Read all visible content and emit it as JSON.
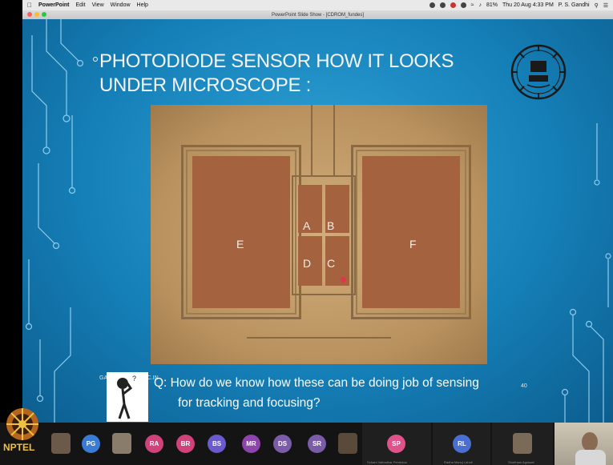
{
  "menubar": {
    "app_name": "PowerPoint",
    "menus": [
      "Edit",
      "View",
      "Window",
      "Help"
    ],
    "battery": "81%",
    "datetime": "Thu 20 Aug  4:33 PM",
    "user": "P. S. Gandhi"
  },
  "window": {
    "title": "PowerPoint Slide Show - [CDROM_fundes]"
  },
  "slide": {
    "title": "PHOTODIODE SENSOR HOW IT LOOKS UNDER MICROSCOPE :",
    "labels": {
      "e": "E",
      "f": "F",
      "a": "A",
      "b": "B",
      "c": "C",
      "d": "D"
    },
    "footer_left": "GA",
    "footer_mid": "AC.IN",
    "page_number": "40",
    "question_line1": "Q: How do we know how these can be doing job of sensing",
    "question_line2": "for tracking and focusing?"
  },
  "participants": [
    {
      "initials": "PG",
      "color": "#3a7bd5"
    },
    {
      "initials": "RA",
      "color": "#d0427a"
    },
    {
      "initials": "BR",
      "color": "#d0427a"
    },
    {
      "initials": "BS",
      "color": "#6a5acd"
    },
    {
      "initials": "MR",
      "color": "#8e44ad"
    },
    {
      "initials": "DS",
      "color": "#7b5ca8"
    },
    {
      "initials": "SR",
      "color": "#7b5ca8"
    },
    {
      "initials": "SP",
      "color": "#e0528a",
      "name": "Soham Vaibadhar Pendukar"
    },
    {
      "initials": "RL",
      "color": "#4a6fd0",
      "name": "Radha Manoj Lahoti"
    },
    {
      "name": "Shubham Agrawal"
    }
  ],
  "branding": {
    "nptel": "NPTEL"
  }
}
